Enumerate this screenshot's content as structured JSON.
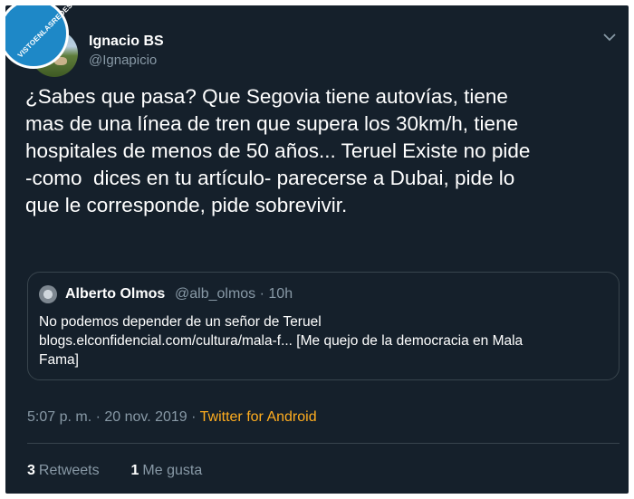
{
  "watermark": {
    "text": "VISTOENLASREDES"
  },
  "author": {
    "name": "Ignacio BS",
    "handle": "@Ignapicio"
  },
  "menu_icon": "chevron-down-icon",
  "tweet": {
    "text": "¿Sabes que pasa? Que Segovia tiene autovías, tiene\nmas de una línea de tren que supera los 30km/h, tiene\nhospitales de menos de 50 años... Teruel Existe no pide\n-como  dices en tu artículo- parecerse a Dubai, pide lo\nque le corresponde, pide sobrevivir."
  },
  "quoted": {
    "name": "Alberto Olmos",
    "handle_time": "@alb_olmos · 10h",
    "text_line1": "No podemos depender de un señor de Teruel",
    "text_line2": "blogs.elconfidencial.com/cultura/mala-f... [Me quejo de la democracia en Mala",
    "text_line3": "Fama]"
  },
  "meta": {
    "time": "5:07 p. m. · 20 nov. 2019 · ",
    "source": "Twitter for Android"
  },
  "stats": {
    "retweets_count": "3",
    "retweets_label": "Retweets",
    "likes_count": "1",
    "likes_label": "Me gusta"
  },
  "colors": {
    "background": "#15202b",
    "text": "#ffffff",
    "secondary": "#8899a6",
    "source": "#ffad1f",
    "border": "#38444d"
  }
}
